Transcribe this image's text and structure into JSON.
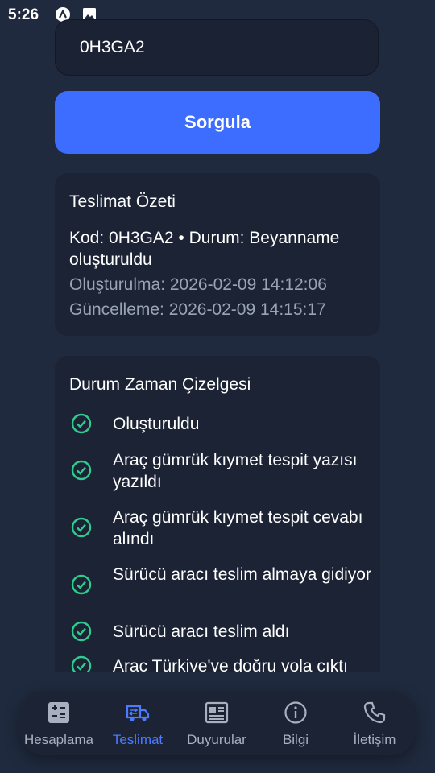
{
  "status_bar": {
    "time": "5:26"
  },
  "search": {
    "code_value": "0H3GA2",
    "button_label": "Sorgula"
  },
  "summary": {
    "title": "Teslimat Özeti",
    "main": "Kod: 0H3GA2 • Durum: Beyanname oluşturuldu",
    "created": "Oluşturulma: 2026-02-09 14:12:06",
    "updated": "Güncelleme: 2026-02-09 14:15:17"
  },
  "timeline": {
    "title": "Durum Zaman Çizelgesi",
    "items": [
      {
        "label": "Oluşturuldu"
      },
      {
        "label": "Araç gümrük kıymet tespit yazısı yazıldı"
      },
      {
        "label": "Araç gümrük kıymet tespit cevabı alındı"
      },
      {
        "label": "Sürücü aracı teslim almaya gidiyor"
      },
      {
        "label": "Sürücü aracı teslim aldı"
      },
      {
        "label": "Araç Türkiye'ye doğru yola çıktı"
      }
    ],
    "check_color": "#2ecc8f"
  },
  "nav": {
    "items": [
      {
        "label": "Hesaplama",
        "icon": "calculator-icon"
      },
      {
        "label": "Teslimat",
        "icon": "truck-icon",
        "active": true
      },
      {
        "label": "Duyurular",
        "icon": "newspaper-icon"
      },
      {
        "label": "Bilgi",
        "icon": "info-icon"
      },
      {
        "label": "İletişim",
        "icon": "phone-icon"
      }
    ],
    "active_color": "#4d7bff"
  }
}
